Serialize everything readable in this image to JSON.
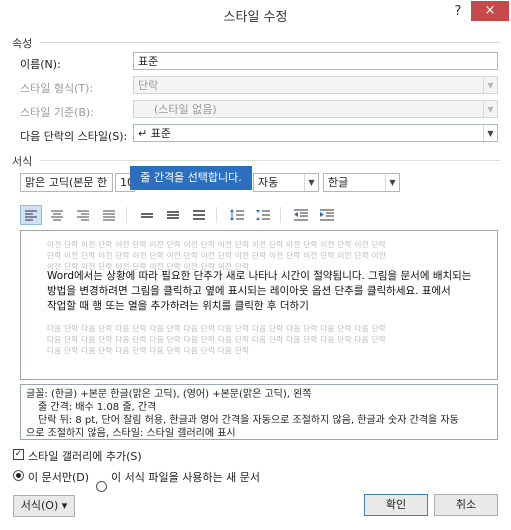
{
  "window": {
    "title": "스타일 수정",
    "help_label": "?",
    "close_label": "×"
  },
  "properties": {
    "section_label": "속성",
    "name_label": "이름(N):",
    "name_value": "표준",
    "style_type_label": "스타일 형식(T):",
    "style_type_value": "단락",
    "based_on_label": "스타일 기준(B):",
    "based_on_value": "(스타일 없음)",
    "next_label": "다음 단락의 스타일(S):",
    "next_value": "↵ 표준"
  },
  "formatting": {
    "section_label": "서식",
    "font_value": "맑은 고딕(본문 한",
    "size_value": "10",
    "color_value": "자동",
    "script_value": "한글",
    "tooltip": "줄 간격을 선택합니다."
  },
  "preview": {
    "prev_para_lines": [
      "이전 단락 이전 단락 이전 단락 이전 단락 이전 단락 이전 단락 이전 단락 이전 단락 이전 단락 이전 단락",
      "단락 이전 단락 이전 단락 이전 단락 이전 단락 이전 단락 이전 단락 이전 단락 이전 단락 이전 단락 이전",
      "이전 단락 이전 단락 이전 단락 이전 단락 이전 단락 이전 단락"
    ],
    "sample_lines": [
      "Word에서는 상황에 따라 필요한 단추가 새로 나타나 시간이 절약됩니다. 그림을 문서에 배치되는",
      "방법을 변경하려면 그림을 클릭하고 옆에 표시되는 레이아웃 옵션 단추를 클릭하세요. 표에서",
      "작업할 때 행 또는 열을 추가하려는 위치를 클릭한 후 더하기"
    ],
    "next_para_lines": [
      "다음 단락 다음 단락 다음 단락 다음 단락 다음 단락 다음 단락 다음 단락 다음 단락 다음 단락 다음 단락",
      "다음 단락 다음 단락 다음 단락 다음 단락 다음 단락 다음 단락 다음 단락 다음 단락 다음 단락 다음 단락",
      "다음 단락 다음 단락 다음 단락 다음 단락 다음 단락 다음 단락"
    ]
  },
  "description": {
    "line1": "글꼴: (한글) +본문 한글(맑은 고딕), (영어) +본문(맑은 고딕), 왼쪽",
    "line2": "줄 간격: 배수 1.08 줄, 간격",
    "line3": "단락 뒤: 8 pt, 단어 잘림 허용, 한글과 영어 간격을 자동으로 조절하지 않음, 한글과 숫자 간격을 자동",
    "line4": "으로 조절하지 않음, 스타일: 스타일 갤러리에 표시"
  },
  "options": {
    "gallery_label": "스타일 갤러리에 추가(S)",
    "gallery_checked": true,
    "this_doc_label": "이 문서만(D)",
    "template_label": "이 서식 파일을 사용하는 새 문서"
  },
  "buttons": {
    "format_label": "서식(O) ▾",
    "ok_label": "확인",
    "cancel_label": "취소"
  }
}
